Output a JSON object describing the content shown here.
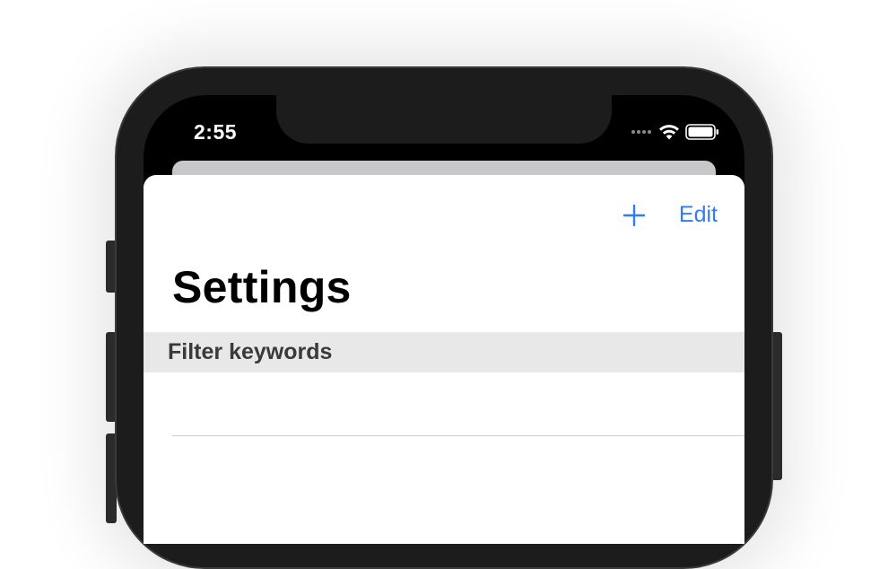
{
  "status_bar": {
    "time": "2:55",
    "icons": [
      "cellular-dots-icon",
      "wifi-icon",
      "battery-icon"
    ]
  },
  "nav_bar": {
    "add_icon": "plus-icon",
    "edit_label": "Edit"
  },
  "page": {
    "title": "Settings"
  },
  "section": {
    "header": "Filter keywords"
  },
  "colors": {
    "accent": "#2f7cf6",
    "section_bg": "#e8e8e8",
    "frame": "#1c1c1c"
  }
}
